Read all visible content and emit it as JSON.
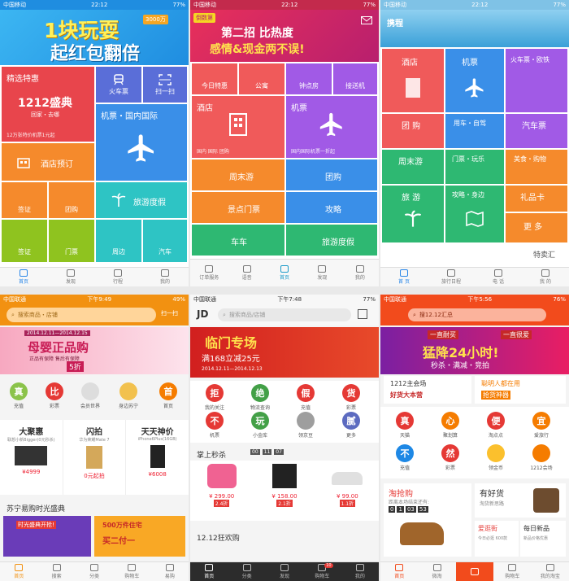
{
  "status": {
    "carrier_top": "中国移动",
    "carrier_bottom": "中国联通",
    "carrier_p4": "中国联通",
    "time_p1": "22:12",
    "time_p2": "22:12",
    "time_p3": "22:12",
    "time_p4": "下午9:49",
    "time_p5": "下午7:48",
    "time_p6": "下午5:56",
    "battery_p1": "77%",
    "battery_p2": "77%",
    "battery_p3": "77%",
    "battery_p4": "49%",
    "battery_p5": "77%",
    "battery_p6": "76%"
  },
  "p1": {
    "banner_line1": "1块玩耍",
    "banner_line2": "起红包翻倍",
    "banner_badge": "3000万",
    "tile_promo_title": "精选特惠",
    "tile_promo_big": "1212盛典",
    "tile_promo_sub": "回家・去哪",
    "tile_promo_foot": "12万张特价机票1元起",
    "tile_train": "火车票",
    "tile_scan": "扫一扫",
    "tile_flight": "机票・国内国际",
    "tile_hotel": "酒店预订",
    "tile_tour": "旅游度假",
    "tile_a": "签证",
    "tile_b": "团购",
    "tile_c": "签证",
    "tile_d": "门票",
    "tile_e": "周边",
    "tile_f": "汽车",
    "tabs": [
      "首页",
      "发现",
      "行程",
      "我的"
    ]
  },
  "p2": {
    "banner_tag": "倒数第",
    "banner_line1": "第二招 比热度",
    "banner_line2": "感情&现金两不误!",
    "tile_orders": "今日特惠",
    "tile_apartment": "公寓",
    "tile_hourly": "钟点房",
    "tile_transfer": "接送机",
    "tile_hotel": "酒店",
    "tile_hotel_sub": "国内 国际 团购",
    "tile_flight": "机票",
    "tile_flight_sub": "国内国际机票一折起",
    "tile_weekend": "周末游",
    "tile_group": "团购",
    "tile_sight": "景点门票",
    "tile_guide": "攻略",
    "tile_car": "车车",
    "tile_tour": "旅游度假",
    "tabs": [
      "订单服务",
      "语音",
      "首页",
      "发现",
      "我的"
    ]
  },
  "p3": {
    "logo": "携程",
    "tile_hotel": "酒店",
    "tile_flight": "机票",
    "tile_train": "火车票・欧铁",
    "tile_group": "团 购",
    "tile_car": "用车・自驾",
    "tile_bus": "汽车票",
    "tile_weekend": "周末游",
    "tile_ticket": "门票・玩乐",
    "tile_food": "美食・购物",
    "tile_travel": "旅 游",
    "tile_guide": "攻略・身边",
    "tile_gift": "礼品卡",
    "tile_more": "更 多",
    "tile_special": "特卖汇",
    "tabs": [
      "首 页",
      "旅行日程",
      "电 话",
      "我 的"
    ]
  },
  "p4": {
    "search_placeholder": "搜索商品・店铺",
    "scan": "扫一扫",
    "banner_date": "2014.12.11—2014.12.15",
    "banner_title": "母婴正品购",
    "banner_sub": "正品有保障 售后有保障",
    "banner_price": "5折",
    "icons": [
      "充值",
      "彩票",
      "会员世界",
      "身边苏宁",
      "首页"
    ],
    "icon_chars": [
      "真",
      "比",
      "",
      "",
      "首"
    ],
    "deal_titles": [
      "大聚惠",
      "闪拍",
      "天天神价"
    ],
    "deal_subs": [
      "联想小新Bigger(0元秒杀)",
      "华为荣耀Mate 7",
      "iPhone6Plus(16GB)"
    ],
    "deal_prices": [
      "¥4999",
      "0元起拍",
      "¥6008"
    ],
    "section_title": "苏宁易购时光盛典",
    "promo1": "时光盛典开抢!",
    "promo2": "500万件住宅",
    "promo2_sub": "买二付一",
    "tabs": [
      "首页",
      "搜索",
      "分类",
      "购物车",
      "易购"
    ]
  },
  "p5": {
    "logo": "JD",
    "search_placeholder": "搜索商品/店铺",
    "banner_title": "临门专场",
    "banner_sub": "满168立减25元",
    "banner_date": "2014.12.11—2014.12.13",
    "icons": [
      "拒",
      "绝",
      "假",
      "货",
      "不",
      "玩",
      "",
      "腻"
    ],
    "icon_labels": [
      "我的关注",
      "物流查询",
      "充值",
      "彩票",
      "机票",
      "小金库",
      "领京豆",
      "更多"
    ],
    "seckill_title": "掌上秒杀",
    "seckill_time": [
      "00",
      "11",
      "07"
    ],
    "products": [
      "¥ 299.00",
      "¥ 158.00",
      "¥ 99.00"
    ],
    "product_tags": [
      "2.4折",
      "2.1折",
      "1.1折"
    ],
    "section2": "12.12狂欢购",
    "tabs": [
      "首页",
      "分类",
      "发现",
      "购物车",
      "我的"
    ],
    "cart_badge": "10"
  },
  "p6": {
    "search_placeholder": "搜12.12汇总",
    "banner_top": "一直耐买",
    "banner_top2": "一直很爱",
    "banner_title": "猛降24小时!",
    "banner_sub": "秒杀・满减・竞拍",
    "card1_title": "1212主会场",
    "card1_sub": "好货大本营",
    "card2_title": "聪明人都在用",
    "card2_sub": "抢货神器",
    "icons": [
      "真",
      "心",
      "便",
      "宜",
      "不",
      "然",
      "",
      ""
    ],
    "icon_labels": [
      "天猫",
      "聚划算",
      "淘点点",
      "爱旅行",
      "充值",
      "彩票",
      "领金币",
      "1212会场"
    ],
    "deal1_title": "淘抢购",
    "deal1_sub": "距离本场结束还有:",
    "deal1_timer": [
      "0",
      "1",
      "03",
      "53"
    ],
    "deal2_title": "有好货",
    "deal2_sub": "淘货新思路",
    "deal3": "爱逛街",
    "deal3_sub": "今日必逛 600款",
    "deal4": "每日新品",
    "deal4_sub": "新品价格优惠",
    "tabs": [
      "首页",
      "微淘",
      "",
      "购物车",
      "我的淘宝"
    ]
  }
}
